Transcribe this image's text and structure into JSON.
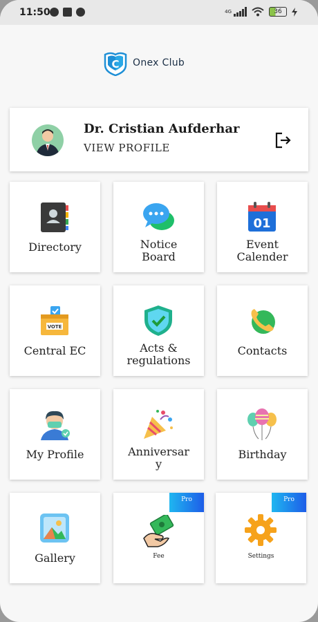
{
  "status_bar": {
    "time": "11:50",
    "network": "4G",
    "battery": "36"
  },
  "brand": {
    "name": "Onex Club",
    "logo_letter": "C"
  },
  "profile": {
    "name": "Dr. Cristian Aufderhar",
    "view_label": "VIEW PROFILE"
  },
  "tiles": [
    {
      "label": "Directory",
      "icon": "address-book-icon"
    },
    {
      "label": "Notice\nBoard",
      "icon": "chat-bubbles-icon"
    },
    {
      "label": "Event\nCalender",
      "icon": "calendar-icon",
      "calendar_day": "01"
    },
    {
      "label": "Central EC",
      "icon": "ballot-box-icon",
      "ballot_text": "VOTE"
    },
    {
      "label": "Acts &\nregulations",
      "icon": "shield-check-icon"
    },
    {
      "label": "Contacts",
      "icon": "phone-icon"
    },
    {
      "label": "My Profile",
      "icon": "user-mask-icon"
    },
    {
      "label": "Anniversar\ny",
      "icon": "party-popper-icon"
    },
    {
      "label": "Birthday",
      "icon": "balloons-icon"
    },
    {
      "label": "Gallery",
      "icon": "gallery-icon"
    },
    {
      "label": "Fee",
      "icon": "cash-hand-icon",
      "badge": "Pro"
    },
    {
      "label": "Settings",
      "icon": "gear-icon",
      "badge": "Pro"
    }
  ]
}
